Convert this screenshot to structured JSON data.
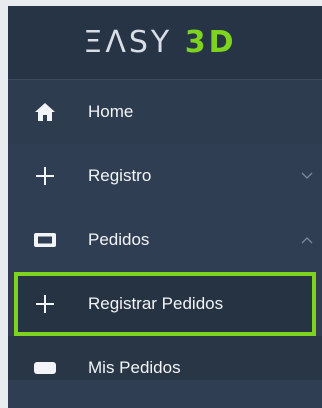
{
  "brand": {
    "logo_main": "ΞΛSY ",
    "logo_accent": "3D"
  },
  "menu": {
    "items": [
      {
        "label": "Home",
        "icon": "home-icon"
      },
      {
        "label": "Registro",
        "icon": "plus-icon",
        "chevron": "chevron-down-icon"
      },
      {
        "label": "Pedidos",
        "icon": "ticket-icon",
        "chevron": "chevron-up-icon"
      },
      {
        "label": "Registrar Pedidos",
        "icon": "plus-icon",
        "highlighted": true
      },
      {
        "label": "Mis Pedidos",
        "icon": "ticket-icon"
      }
    ]
  },
  "colors": {
    "sidebar_bg": "#2f3e52",
    "brand_bg": "#263445",
    "accent_green": "#7ed321",
    "text": "#f2f4f7",
    "page_bg": "#e9ecef"
  }
}
